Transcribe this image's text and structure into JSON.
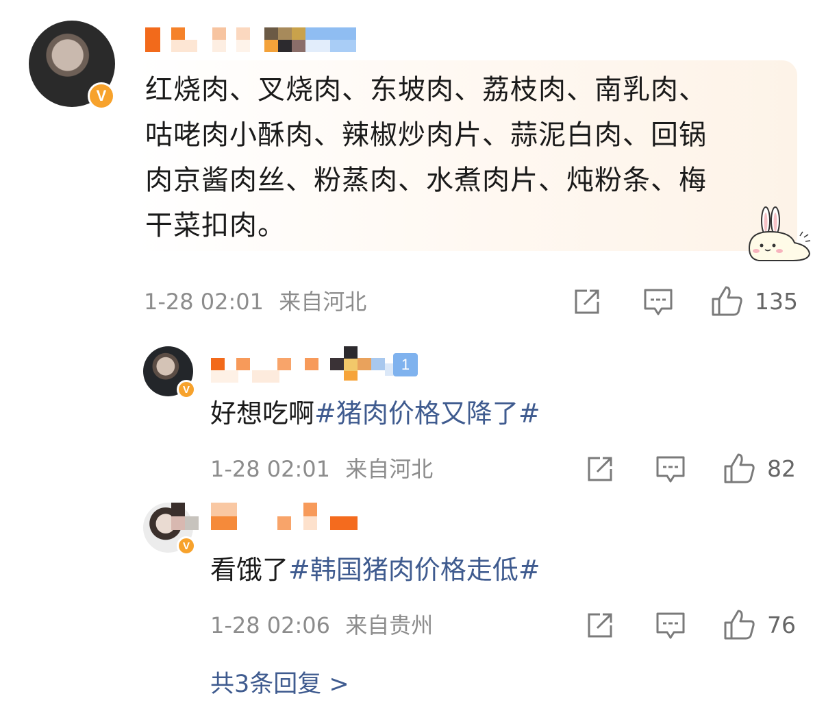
{
  "comment": {
    "text": "红烧肉、叉烧肉、东坡肉、荔枝肉、南乳肉、咕咾肉小酥肉、辣椒炒肉片、蒜泥白肉、回锅肉京酱肉丝、粉蒸肉、水煮肉片、炖粉条、梅干菜扣肉。",
    "lines": [
      "红烧肉、叉烧肉、东坡肉、荔枝肉、南乳肉、",
      "咕咾肉小酥肉、辣椒炒肉片、蒜泥白肉、回锅",
      "肉京酱肉丝、粉蒸肉、水煮肉片、炖粉条、梅",
      "干菜扣肉。"
    ],
    "timestamp": "1-28 02:01",
    "location": "来自河北",
    "likes": "135",
    "badge": "V"
  },
  "replies": [
    {
      "prefix": "好想吃啊",
      "hashtag": "#猪肉价格又降了#",
      "timestamp": "1-28 02:01",
      "location": "来自河北",
      "likes": "82",
      "badge": "V",
      "level_badge": "1"
    },
    {
      "prefix": "看饿了",
      "hashtag": "#韩国猪肉价格走低#",
      "timestamp": "1-28 02:06",
      "location": "来自贵州",
      "likes": "76",
      "badge": "V"
    }
  ],
  "more_replies": "共3条回复 >",
  "icons": {
    "share": "share-icon",
    "comment": "comment-icon",
    "like": "thumbs-up-icon"
  },
  "colors": {
    "hashtag": "#3f5b8f",
    "badge": "#f7a22c",
    "meta": "#8c8c8c"
  }
}
